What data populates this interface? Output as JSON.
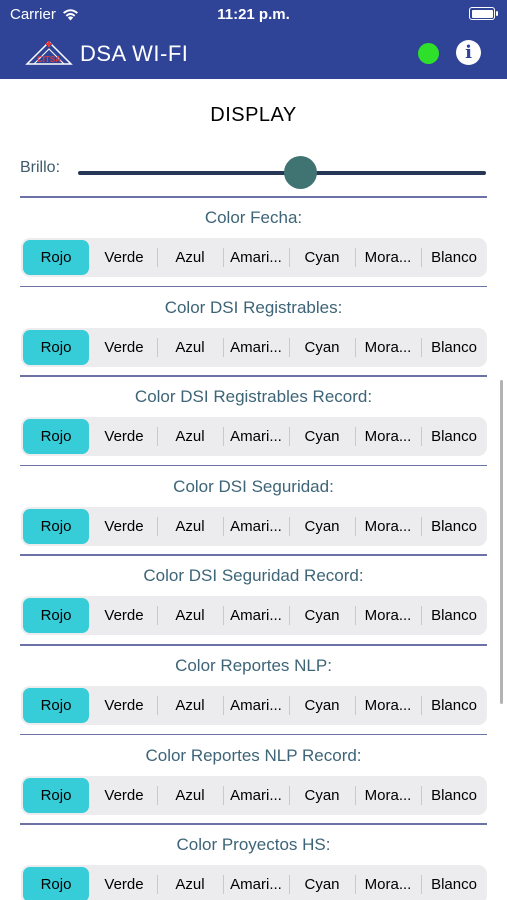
{
  "status_bar": {
    "carrier": "Carrier",
    "time": "11:21 p.m."
  },
  "nav": {
    "title": "DSA WI-FI",
    "logo_text": "CITSA",
    "connection_color": "#2fe02b",
    "info_label": "i"
  },
  "display": {
    "title": "DISPLAY"
  },
  "brightness": {
    "label": "Brillo:",
    "value_fraction": 0.55
  },
  "colors": {
    "header": "#2f4497",
    "selected_segment": "#36cdd8",
    "divider": "#6c71a6",
    "section_title": "#3d6477"
  },
  "sections": [
    {
      "title": "Color Fecha:",
      "selected": "Rojo"
    },
    {
      "title": "Color DSI Registrables:",
      "selected": "Rojo"
    },
    {
      "title": "Color DSI Registrables Record:",
      "selected": "Rojo"
    },
    {
      "title": "Color DSI Seguridad:",
      "selected": "Rojo"
    },
    {
      "title": "Color DSI Seguridad Record:",
      "selected": "Rojo"
    },
    {
      "title": "Color Reportes NLP:",
      "selected": "Rojo"
    },
    {
      "title": "Color Reportes NLP Record:",
      "selected": "Rojo"
    },
    {
      "title": "Color Proyectos HS:",
      "selected": "Rojo"
    }
  ],
  "options": [
    "Rojo",
    "Verde",
    "Azul",
    "Amari...",
    "Cyan",
    "Mora...",
    "Blanco"
  ]
}
